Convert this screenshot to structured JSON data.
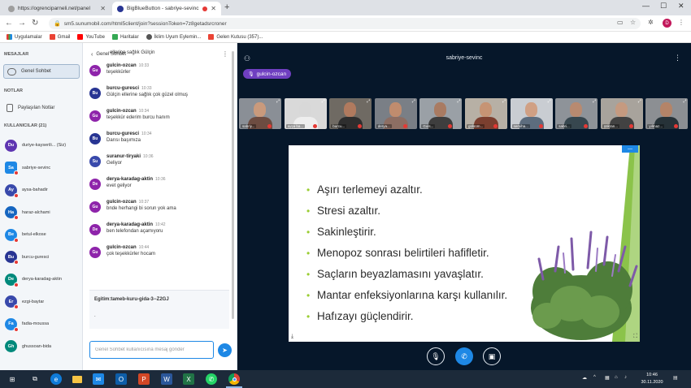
{
  "browser": {
    "tabs": [
      {
        "label": "https://ogrenciparneli.net/panel",
        "active": false
      },
      {
        "label": "BigBlueButton - sabriye-sevinc",
        "active": true
      }
    ],
    "url": "sm5.sunumobil.com/html5client/join?sessionToken=7z8getadsrcroner",
    "profile_initial": "D",
    "bookmarks": [
      "Uygulamalar",
      "Gmail",
      "YouTube",
      "Haritalar",
      "İklim Uyum Eylemin...",
      "Gelen Kutusu (357)..."
    ]
  },
  "sidebar": {
    "messages_header": "MESAJLAR",
    "public_chat": "Genel Sohbet",
    "notes_header": "NOTLAR",
    "shared_notes": "Paylaşılan Notlar",
    "users_header": "KULLANICILAR (21)",
    "users": [
      {
        "initials": "Du",
        "name": "duriye-kayserili... (Siz)",
        "color": "#5e35b1",
        "square": false,
        "muted": false
      },
      {
        "initials": "Sa",
        "name": "sabriye-sevinc",
        "color": "#1e88e5",
        "square": true,
        "muted": true
      },
      {
        "initials": "Ay",
        "name": "aysa-bahadir",
        "color": "#3949ab",
        "square": false,
        "muted": true
      },
      {
        "initials": "Ha",
        "name": "haraz-alchami",
        "color": "#1565c0",
        "square": false,
        "muted": true
      },
      {
        "initials": "Be",
        "name": "betul-elkose",
        "color": "#1e88e5",
        "square": false,
        "muted": true
      },
      {
        "initials": "Bu",
        "name": "burcu-guresci",
        "color": "#283593",
        "square": false,
        "muted": true
      },
      {
        "initials": "De",
        "name": "derya-karadag-aktin",
        "color": "#00897b",
        "square": false,
        "muted": true
      },
      {
        "initials": "Er",
        "name": "ezgi-baytar",
        "color": "#3949ab",
        "square": false,
        "muted": true
      },
      {
        "initials": "Fa",
        "name": "fadia-moussa",
        "color": "#1e88e5",
        "square": false,
        "muted": true
      },
      {
        "initials": "Gh",
        "name": "ghussoan-bida",
        "color": "#00897b",
        "square": false,
        "muted": false
      }
    ]
  },
  "chat": {
    "title": "Genel Sohbet",
    "messages": [
      {
        "initials": "",
        "author": "",
        "time": "",
        "text": "ellerine sağlık Gülçin",
        "color": "#8e24aa"
      },
      {
        "initials": "Gu",
        "author": "gulcin-ozcan",
        "time": "10:33",
        "text": "teşekkürler",
        "color": "#8e24aa"
      },
      {
        "initials": "Bu",
        "author": "burcu-guresci",
        "time": "10:33",
        "text": "Gülçin ellerine sağlık çok güzel olmuş",
        "color": "#283593"
      },
      {
        "initials": "Gu",
        "author": "gulcin-ozcan",
        "time": "10:34",
        "text": "teşekkür ederim burcu hanım",
        "color": "#8e24aa"
      },
      {
        "initials": "Bu",
        "author": "burcu-guresci",
        "time": "10:34",
        "text": "Darısı başımıza",
        "color": "#283593"
      },
      {
        "initials": "Su",
        "author": "suranur-tiryaki",
        "time": "10:36",
        "text": "Geliyor",
        "color": "#3949ab"
      },
      {
        "initials": "De",
        "author": "derya-karadag-aktin",
        "time": "10:36",
        "text": "evet geliyor",
        "color": "#8e24aa"
      },
      {
        "initials": "Gu",
        "author": "gulcin-ozcan",
        "time": "10:37",
        "text": "bnde herhangi bi sorun yok ama",
        "color": "#8e24aa"
      },
      {
        "initials": "De",
        "author": "derya-karadag-aktin",
        "time": "10:42",
        "text": "ben telefondan açamıyoru",
        "color": "#8e24aa"
      },
      {
        "initials": "Gu",
        "author": "gulcin-ozcan",
        "time": "10:44",
        "text": "çok teşekkürler hocam",
        "color": "#8e24aa"
      }
    ],
    "pinned_title": "Egitim:tameb-kuru-gida-3--Z2GJ",
    "pinned_sub": ".",
    "input_placeholder": "Genel Sohbet kullanıcısına mesaj gönder"
  },
  "stage": {
    "presenter": "sabriye-sevinc",
    "talker": "gulcin-ozcan",
    "videos": [
      {
        "name": "sabriy...",
        "skin": "#c99a7c",
        "shirt": "#6d4c41",
        "bg": "#8a8f96"
      },
      {
        "name": "ayşa ba...",
        "skin": "#d8d8d8",
        "shirt": "#eeeeee",
        "bg": "#d9d9d9"
      },
      {
        "name": "burcu...",
        "skin": "#b07a5e",
        "shirt": "#2e2e2e",
        "bg": "#6f6a63"
      },
      {
        "name": "derya...",
        "skin": "#c08c6e",
        "shirt": "#8d6e63",
        "bg": "#7a7f86"
      },
      {
        "name": "Guls...",
        "skin": "#a97b62",
        "shirt": "#3e3e3e",
        "bg": "#9aa0a6"
      },
      {
        "name": "gülsüm...",
        "skin": "#c69474",
        "shirt": "#7b3f2f",
        "bg": "#b7b0a5"
      },
      {
        "name": "semiha...",
        "skin": "#d0a084",
        "shirt": "#5d6d7e",
        "bg": "#c9cdd2"
      },
      {
        "name": "sabri...",
        "skin": "#b88a70",
        "shirt": "#37474f",
        "bg": "#8e9399"
      },
      {
        "name": "şükran...",
        "skin": "#c59a80",
        "shirt": "#424242",
        "bg": "#a8a39c"
      },
      {
        "name": "yılmaz...",
        "skin": "#b48468",
        "shirt": "#263238",
        "bg": "#8c8f93"
      }
    ],
    "slide_bullets": [
      "Aşırı terlemeyi azaltır.",
      "Stresi azaltır.",
      "Sakinleştirir.",
      "Menopoz sonrası belirtileri hafifletir.",
      "Saçların beyazlamasını yavaşlatır.",
      "Mantar enfeksiyonlarına karşı kullanılır.",
      "Hafızayı güçlendirir."
    ],
    "accent_color": "#8bc34a"
  },
  "taskbar": {
    "time": "10:46",
    "date": "30.11.2020"
  }
}
